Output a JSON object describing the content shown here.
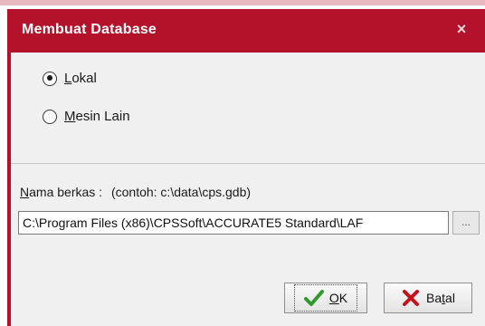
{
  "dialog": {
    "title": "Membuat Database",
    "close_glyph": "×"
  },
  "location": {
    "options": [
      {
        "label": "Lokal",
        "access_key": "L",
        "checked": true
      },
      {
        "label": "Mesin Lain",
        "access_key": "M",
        "checked": false
      }
    ]
  },
  "file": {
    "label": "Nama berkas :",
    "label_access_key": "N",
    "hint": "(contoh: c:\\data\\cps.gdb)",
    "path_value": "C:\\Program Files (x86)\\CPSSoft\\ACCURATE5 Standard\\LAF",
    "browse_label": "..."
  },
  "buttons": {
    "ok_label": "OK",
    "ok_access_key": "O",
    "cancel_label": "Batal",
    "cancel_access_key": "t"
  },
  "colors": {
    "titlebar": "#b3122a",
    "ok_icon": "#2e9a2e",
    "cancel_icon": "#c4121c"
  }
}
